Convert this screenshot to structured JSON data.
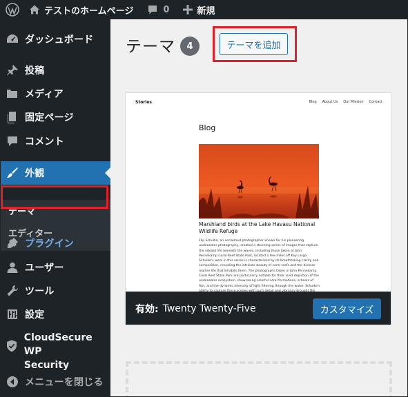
{
  "adminbar": {
    "site_name": "テストのホームページ",
    "comments_count": "0",
    "new_label": "新規"
  },
  "sidebar": {
    "items": [
      {
        "label": "ダッシュボード",
        "icon": "dashboard-icon"
      },
      {
        "label": "投稿",
        "icon": "pin-icon"
      },
      {
        "label": "メディア",
        "icon": "media-icon"
      },
      {
        "label": "固定ページ",
        "icon": "page-icon"
      },
      {
        "label": "コメント",
        "icon": "comment-icon"
      },
      {
        "label": "外観",
        "icon": "brush-icon"
      },
      {
        "label": "プラグイン",
        "icon": "plugin-icon"
      },
      {
        "label": "ユーザー",
        "icon": "user-icon"
      },
      {
        "label": "ツール",
        "icon": "wrench-icon"
      },
      {
        "label": "設定",
        "icon": "settings-icon"
      },
      {
        "label_line1": "CloudSecure WP",
        "label_line2": "Security",
        "icon": "shield-check-icon"
      },
      {
        "label": "メニューを閉じる",
        "icon": "collapse-icon"
      }
    ],
    "submenu": {
      "current": "テーマ",
      "editor": "エディター"
    }
  },
  "main": {
    "title": "テーマ",
    "theme_count": "4",
    "add_button_label": "テーマを追加"
  },
  "theme": {
    "active_prefix": "有効:",
    "name": "Twenty Twenty-Five",
    "customize_label": "カスタマイズ",
    "screenshot": {
      "site_title": "Stories",
      "nav": [
        "Blog",
        "About Us",
        "Our Mission",
        "Contact"
      ],
      "heading": "Blog",
      "post_title": "Marshland birds at the Lake Havasu National Wildlife Refuge",
      "body": "Flip Schulke, an acclaimed photographer known for his pioneering underwater photography, created a stunning series of images that capture the vibrant life beneath the waves, including those taken at John Pennekamp Coral Reef State Park, located a few miles off Key Largo. Schulke's work in this series is characterized by its breathtaking clarity and composition, revealing the intricate beauty of coral reefs and the diverse marine life that inhabits them. The photographs taken in John Pennekamp Coral Reef State Park are particularly notable for their vivid depiction of the underwater ecosystem, showcasing colorful coral formations, schools of fish, and the dynamic interplay of light filtering through the water. Schulke's ability to capture these scenes with such detail and vibrancy brought the hidden wonders of the ocean to the public's eye, fostering a greater appreciation for marine conservation. His images not only highlight the aesthetic beauty of underwater environments but"
    }
  },
  "colors": {
    "admin_dark": "#1d2327",
    "accent_blue": "#2271b1",
    "highlight_red": "#e3202a"
  }
}
